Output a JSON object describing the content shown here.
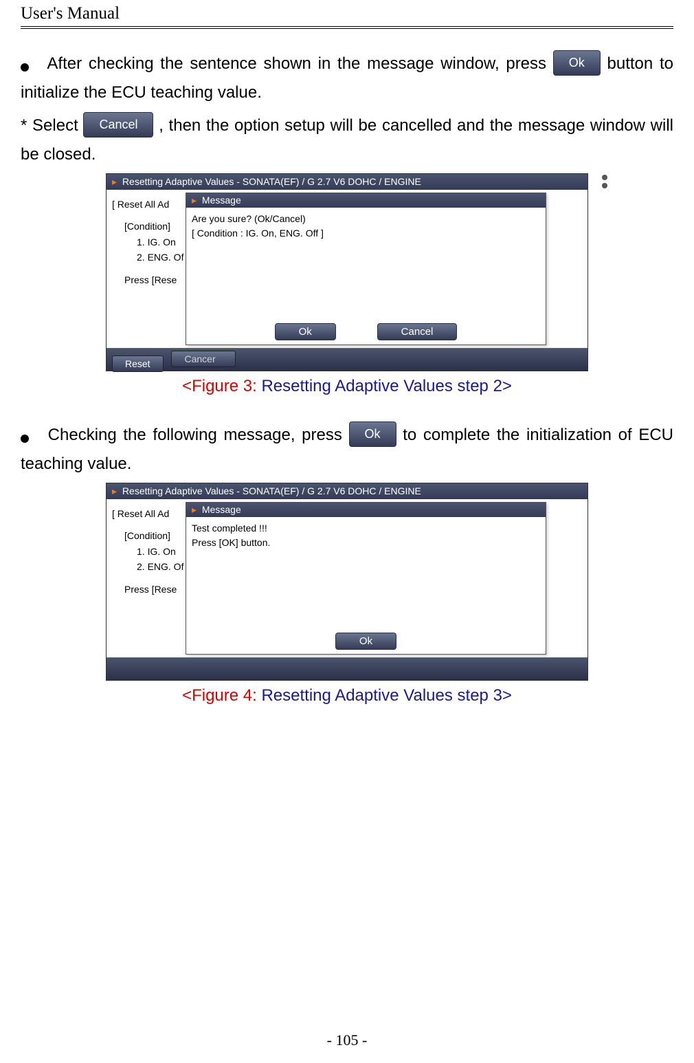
{
  "page": {
    "header": "User's Manual",
    "footer_page_number": "- 105 -"
  },
  "btn_label": {
    "ok": "Ok",
    "cancel": "Cancel"
  },
  "para1": {
    "lead": "After checking the sentence shown in the message window, press",
    "tail": " button to initialize the ECU teaching value."
  },
  "para2": {
    "lead": "* Select ",
    "tail": ", then the option setup will be cancelled and the message window will be closed."
  },
  "para3": {
    "lead": "Checking the following message, press ",
    "tail": " to complete the initialization of ECU teaching value."
  },
  "fig3": {
    "num": "<Figure 3:",
    "caption": " Resetting Adaptive Values step 2>",
    "app_title": "Resetting Adaptive Values - SONATA(EF) / G 2.7 V6 DOHC / ENGINE",
    "left_lines": [
      "[ Reset All Ad",
      "[Condition]",
      "1. IG. On",
      "2. ENG. Of",
      "Press [Rese"
    ],
    "msg_title": "Message",
    "msg_lines": [
      "Are you sure? (Ok/Cancel)",
      "[ Condition : IG. On, ENG. Off ]"
    ],
    "bottom_left": "Reset",
    "bottom_cut": "Cancer"
  },
  "fig4": {
    "num": "<Figure 4:",
    "caption": " Resetting Adaptive Values step 3>",
    "app_title": "Resetting Adaptive Values - SONATA(EF) / G 2.7 V6 DOHC / ENGINE",
    "left_lines": [
      "[ Reset All Ad",
      "[Condition]",
      "1. IG. On",
      "2. ENG. Of",
      "Press [Rese"
    ],
    "msg_title": "Message",
    "msg_lines": [
      "Test completed !!!",
      "Press [OK] button."
    ]
  }
}
